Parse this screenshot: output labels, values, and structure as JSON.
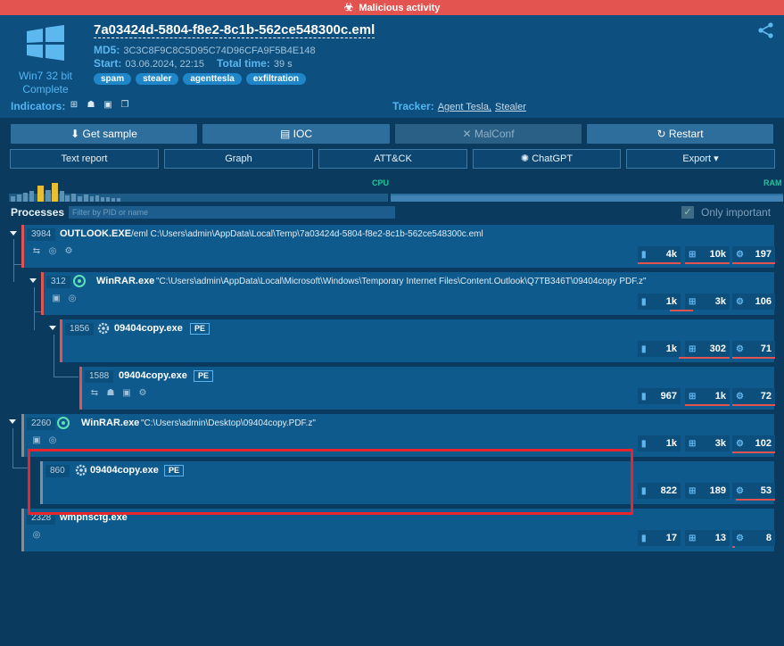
{
  "banner": "Malicious activity",
  "header": {
    "filename": "7a03424d-5804-f8e2-8c1b-562ce548300c.eml",
    "md5_label": "MD5:",
    "md5": "3C3C8F9C8C5D95C74D96CFA9F5B4E148",
    "start_label": "Start:",
    "start": "03.06.2024, 22:15",
    "total_label": "Total time:",
    "total": "39 s",
    "os": "Win7 32 bit",
    "status": "Complete",
    "tags": [
      "spam",
      "stealer",
      "agenttesla",
      "exfiltration"
    ],
    "indicators_label": "Indicators:",
    "tracker_label": "Tracker:",
    "trackers": [
      "Agent Tesla,",
      "Stealer"
    ]
  },
  "buttons": {
    "get_sample": "Get sample",
    "ioc": "IOC",
    "malconf": "MalConf",
    "restart": "Restart",
    "text_report": "Text report",
    "graph": "Graph",
    "attck": "ATT&CK",
    "chatgpt": "ChatGPT",
    "export": "Export"
  },
  "charts": {
    "cpu": "CPU",
    "ram": "RAM"
  },
  "processes": {
    "label": "Processes",
    "filter_placeholder": "Filter by PID or name",
    "only_important": "Only important",
    "rows": [
      {
        "pid": "3984",
        "name": "OUTLOOK.EXE",
        "args": "/eml C:\\Users\\admin\\AppData\\Local\\Temp\\7a03424d-5804-f8e2-8c1b-562ce548300c.eml",
        "files": "4k",
        "reg": "10k",
        "mods": "197"
      },
      {
        "pid": "312",
        "name": "WinRAR.exe",
        "args": "\"C:\\Users\\admin\\AppData\\Local\\Microsoft\\Windows\\Temporary Internet Files\\Content.Outlook\\Q7TB346T\\09404copy PDF.z\"",
        "files": "1k",
        "reg": "3k",
        "mods": "106"
      },
      {
        "pid": "1856",
        "name": "09404copy.exe",
        "pe": "PE",
        "files": "1k",
        "reg": "302",
        "mods": "71"
      },
      {
        "pid": "1588",
        "name": "09404copy.exe",
        "pe": "PE",
        "files": "967",
        "reg": "1k",
        "mods": "72"
      },
      {
        "pid": "2260",
        "name": "WinRAR.exe",
        "args": "\"C:\\Users\\admin\\Desktop\\09404copy.PDF.z\"",
        "files": "1k",
        "reg": "3k",
        "mods": "102"
      },
      {
        "pid": "860",
        "name": "09404copy.exe",
        "pe": "PE",
        "files": "822",
        "reg": "189",
        "mods": "53"
      },
      {
        "pid": "2328",
        "name": "wmpnscfg.exe",
        "files": "17",
        "reg": "13",
        "mods": "8"
      }
    ]
  }
}
